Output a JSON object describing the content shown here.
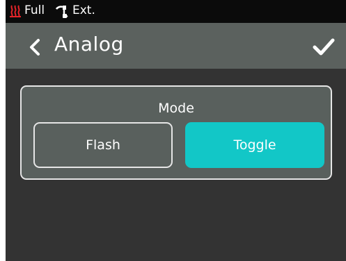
{
  "status_bar": {
    "power_label": "Full",
    "ext_label": "Ext.",
    "heater_icon": "heater-icon",
    "connector_icon": "connector-icon",
    "heater_color": "#e8242a"
  },
  "header": {
    "title": "Analog",
    "back_icon": "chevron-left-icon",
    "confirm_icon": "checkmark-icon"
  },
  "mode": {
    "label": "Mode",
    "options": [
      {
        "label": "Flash",
        "selected": false
      },
      {
        "label": "Toggle",
        "selected": true
      }
    ],
    "accent_color": "#12c7c7"
  }
}
